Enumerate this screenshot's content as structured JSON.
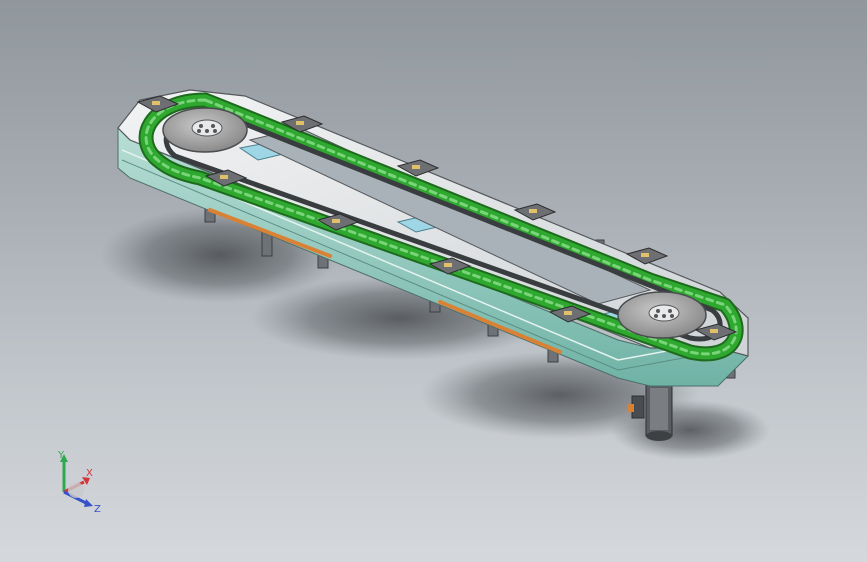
{
  "viewport": {
    "background_top": "#8f969c",
    "background_bottom": "#d5d8dc"
  },
  "model": {
    "frame_color": "#e6e8ea",
    "rail_color": "#9ad6c8",
    "chain_color": "#2ea82e",
    "plate_color": "#6d6f72",
    "sprocket_color": "#9a9a9a",
    "bar_color": "#d98236"
  },
  "triad": {
    "y_label": "Y",
    "x_label": "X",
    "z_label": "Z",
    "y_color": "#2fa84f",
    "x_color": "#d2363a",
    "z_color": "#3651c9"
  }
}
